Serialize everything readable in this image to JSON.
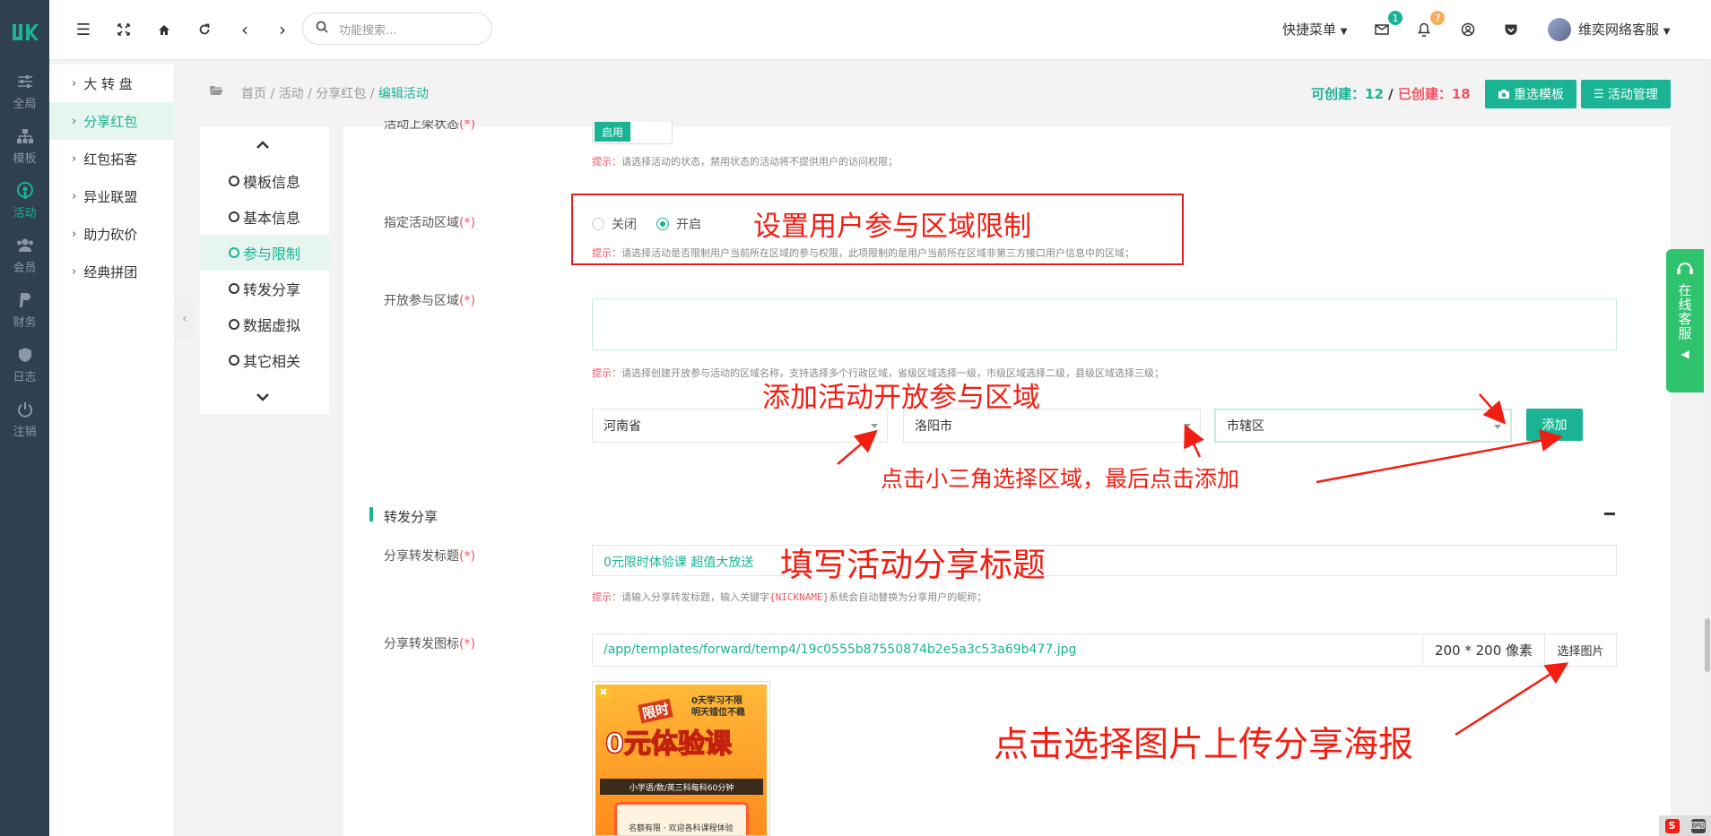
{
  "logo_text": "IJK",
  "rail": [
    {
      "label": "全局",
      "icon": "sliders-icon"
    },
    {
      "label": "模板",
      "icon": "sitemap-icon"
    },
    {
      "label": "活动",
      "icon": "podcast-icon"
    },
    {
      "label": "会员",
      "icon": "users-icon"
    },
    {
      "label": "财务",
      "icon": "paypal-icon"
    },
    {
      "label": "日志",
      "icon": "shield-icon"
    },
    {
      "label": "注销",
      "icon": "power-icon"
    }
  ],
  "submenu": [
    {
      "label": "大 转 盘"
    },
    {
      "label": "分享红包"
    },
    {
      "label": "红包拓客"
    },
    {
      "label": "异业联盟"
    },
    {
      "label": "助力砍价"
    },
    {
      "label": "经典拼团"
    }
  ],
  "topbar": {
    "search_placeholder": "功能搜索...",
    "quick_menu": "快捷菜单",
    "mail_badge": "1",
    "bell_badge": "7",
    "user_name": "维奕网络客服"
  },
  "breadcrumb": {
    "items": [
      "首页",
      "活动",
      "分享红包"
    ],
    "current": "编辑活动",
    "sep": "/"
  },
  "counts": {
    "can_label": "可创建：",
    "can_value": "12",
    "sep": " / ",
    "done_label": "已创建：",
    "done_value": "18"
  },
  "buttons": {
    "reselect_template": "重选模板",
    "activity_manage": "活动管理",
    "add": "添加",
    "choose_image": "选择图片"
  },
  "steps": [
    "模板信息",
    "基本信息",
    "参与限制",
    "转发分享",
    "数据虚拟",
    "其它相关"
  ],
  "form": {
    "status_label_partial": "活动上架状态",
    "status_toggle": "启用",
    "status_hint_tip": "提示：",
    "status_hint": "请选择活动的状态，禁用状态的活动将不提供用户的访问权限；",
    "region_label": "指定活动区域",
    "radio_off": "关闭",
    "radio_on": "开启",
    "region_hint_tip": "提示：",
    "region_hint": "请选择活动是否限制用户当前所在区域的参与权限，此项限制的是用户当前所在区域非第三方接口用户信息中的区域；",
    "open_region_label": "开放参与区域",
    "open_region_hint_tip": "提示：",
    "open_region_hint": "请选择创建开放参与活动的区域名称，支持选择多个行政区域，省级区域选择一级，市级区域选择二级，县级区域选择三级；",
    "province": "河南省",
    "city": "洛阳市",
    "district": "市辖区",
    "section_share": "转发分享",
    "share_title_label": "分享转发标题",
    "share_title_value": "0元限时体验课 超值大放送",
    "share_title_hint_tip": "提示：",
    "share_title_hint_a": "请输入分享转发标题，输入关键字",
    "share_title_keyword": "{NICKNAME}",
    "share_title_hint_b": "系统会自动替换为分享用户的昵称；",
    "share_icon_label": "分享转发图标",
    "share_icon_path": "/app/templates/forward/temp4/19c0555b87550874b2e5a3c53a69b477.jpg",
    "share_icon_size": "200 * 200 像素",
    "req_mark": "(*)"
  },
  "poster": {
    "line1": "0天学习不限",
    "line2": "明天错位不稳",
    "badge": "限时",
    "big": "0元体验课",
    "sub": "小学语/数/英三科每科60分钟",
    "bottom": "名额有限 · 欢迎各科课程体验"
  },
  "annotations": {
    "a1": "设置用户参与区域限制",
    "a2": "添加活动开放参与区域",
    "a3": "点击小三角选择区域，最后点击添加",
    "a4": "填写活动分享标题",
    "a5": "点击选择图片上传分享海报"
  },
  "online_service": "在线客服",
  "colors": {
    "accent": "#1ab394",
    "rail": "#2f4050",
    "annotation": "#f21e12",
    "require": "#ed5565"
  }
}
